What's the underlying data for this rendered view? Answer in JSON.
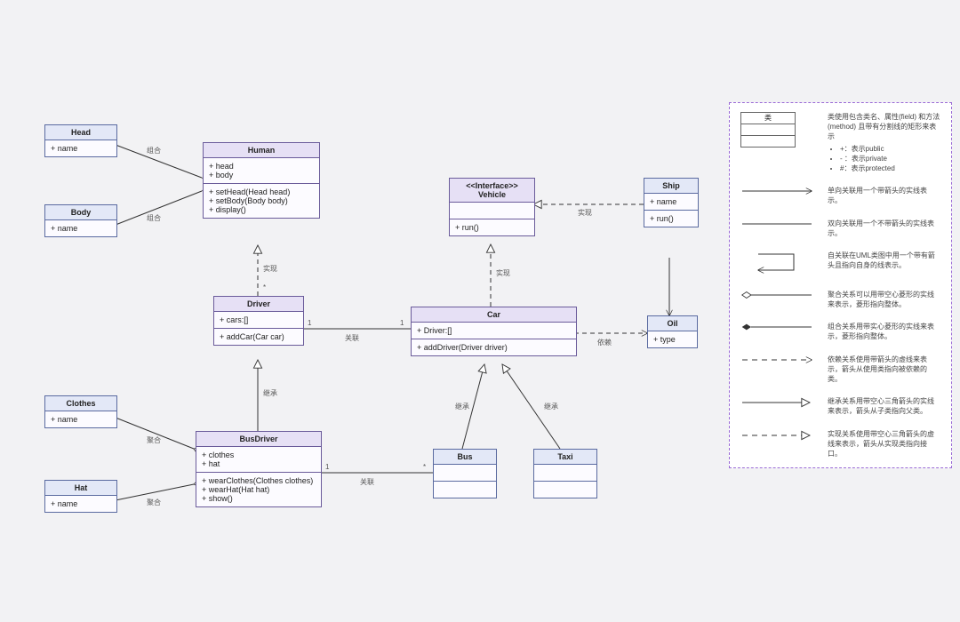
{
  "classes": {
    "Head": {
      "name": "Head",
      "attrs": "+ name",
      "ops": ""
    },
    "Body": {
      "name": "Body",
      "attrs": "+ name",
      "ops": ""
    },
    "Human": {
      "name": "Human",
      "attrs": "+ head\n+ body",
      "ops": "+ setHead(Head head)\n+ setBody(Body body)\n+ display()"
    },
    "Vehicle": {
      "name": "<<Interface>>\nVehicle",
      "attrs": "",
      "ops": "+ run()"
    },
    "Ship": {
      "name": "Ship",
      "attrs": "+ name",
      "ops": "+ run()"
    },
    "Driver": {
      "name": "Driver",
      "attrs": "+ cars:[]",
      "ops": "+ addCar(Car car)"
    },
    "Car": {
      "name": "Car",
      "attrs": "+ Driver:[]",
      "ops": "+ addDriver(Driver driver)"
    },
    "Oil": {
      "name": "Oil",
      "attrs": "+ type",
      "ops": ""
    },
    "Clothes": {
      "name": "Clothes",
      "attrs": "+ name",
      "ops": ""
    },
    "Hat": {
      "name": "Hat",
      "attrs": "+ name",
      "ops": ""
    },
    "BusDriver": {
      "name": "BusDriver",
      "attrs": "+ clothes\n+ hat",
      "ops": "+ wearClothes(Clothes clothes)\n+ wearHat(Hat hat)\n+ show()"
    },
    "Bus": {
      "name": "Bus",
      "attrs": "",
      "ops": ""
    },
    "Taxi": {
      "name": "Taxi",
      "attrs": "",
      "ops": ""
    }
  },
  "edge_labels": {
    "headHuman": "组合",
    "bodyHuman": "组合",
    "humanDriver": "实现",
    "driverBus": "继承",
    "driverCar": "关联",
    "busdriverBus": "关联",
    "clothesBusdriver": "聚合",
    "hatBusdriver": "聚合",
    "carVehicle": "实现",
    "vehicleShip": "实现",
    "carOil": "依赖",
    "carBus": "继承",
    "carTaxi": "继承",
    "one": "1",
    "many": "*"
  },
  "legend": {
    "header": "类",
    "desc_class": "类使用包含类名、属性(field) 和方法(method) 且带有分割线的矩形来表示",
    "vis1": "+：表示public",
    "vis2": "- ：表示private",
    "vis3": "#：表示protected",
    "assoc_uni": "单向关联用一个带箭头的实线表示。",
    "assoc_bi": "双向关联用一个不带箭头的实线表示。",
    "self": "自关联在UML类图中用一个带有箭头且指向自身的线表示。",
    "aggreg": "聚合关系可以用带空心菱形的实线来表示，菱形指向整体。",
    "compose": "组合关系用带实心菱形的实线来表示，菱形指向整体。",
    "depend": "依赖关系使用带箭头的虚线来表示，箭头从使用类指向被依赖的类。",
    "inherit": "继承关系用带空心三角箭头的实线来表示，箭头从子类指向父类。",
    "realize": "实现关系使用带空心三角箭头的虚线来表示，箭头从实现类指向接口。"
  },
  "chart_data": {
    "type": "uml-class-diagram",
    "classes": [
      {
        "name": "Head",
        "attributes": [
          "+ name"
        ],
        "methods": []
      },
      {
        "name": "Body",
        "attributes": [
          "+ name"
        ],
        "methods": []
      },
      {
        "name": "Human",
        "attributes": [
          "+ head",
          "+ body"
        ],
        "methods": [
          "+ setHead(Head head)",
          "+ setBody(Body body)",
          "+ display()"
        ]
      },
      {
        "name": "Vehicle",
        "stereotype": "Interface",
        "attributes": [],
        "methods": [
          "+ run()"
        ]
      },
      {
        "name": "Ship",
        "attributes": [
          "+ name"
        ],
        "methods": [
          "+ run()"
        ]
      },
      {
        "name": "Driver",
        "attributes": [
          "+ cars:[]"
        ],
        "methods": [
          "+ addCar(Car car)"
        ]
      },
      {
        "name": "Car",
        "attributes": [
          "+ Driver:[]"
        ],
        "methods": [
          "+ addDriver(Driver driver)"
        ]
      },
      {
        "name": "Oil",
        "attributes": [
          "+ type"
        ],
        "methods": []
      },
      {
        "name": "Clothes",
        "attributes": [
          "+ name"
        ],
        "methods": []
      },
      {
        "name": "Hat",
        "attributes": [
          "+ name"
        ],
        "methods": []
      },
      {
        "name": "BusDriver",
        "attributes": [
          "+ clothes",
          "+ hat"
        ],
        "methods": [
          "+ wearClothes(Clothes clothes)",
          "+ wearHat(Hat hat)",
          "+ show()"
        ]
      },
      {
        "name": "Bus",
        "attributes": [],
        "methods": []
      },
      {
        "name": "Taxi",
        "attributes": [],
        "methods": []
      }
    ],
    "relationships": [
      {
        "from": "Head",
        "to": "Human",
        "type": "composition",
        "label": "组合"
      },
      {
        "from": "Body",
        "to": "Human",
        "type": "composition",
        "label": "组合"
      },
      {
        "from": "Driver",
        "to": "Human",
        "type": "realization",
        "label": "实现"
      },
      {
        "from": "BusDriver",
        "to": "Driver",
        "type": "inheritance",
        "label": "继承"
      },
      {
        "from": "Driver",
        "to": "Car",
        "type": "association",
        "label": "关联",
        "multiplicity": {
          "from": "1",
          "to": "1"
        }
      },
      {
        "from": "BusDriver",
        "to": "Bus",
        "type": "association",
        "label": "关联",
        "multiplicity": {
          "from": "1",
          "to": "*"
        }
      },
      {
        "from": "Clothes",
        "to": "BusDriver",
        "type": "aggregation",
        "label": "聚合"
      },
      {
        "from": "Hat",
        "to": "BusDriver",
        "type": "aggregation",
        "label": "聚合"
      },
      {
        "from": "Car",
        "to": "Vehicle",
        "type": "realization",
        "label": "实现"
      },
      {
        "from": "Ship",
        "to": "Vehicle",
        "type": "realization",
        "label": "实现"
      },
      {
        "from": "Car",
        "to": "Oil",
        "type": "dependency",
        "label": "依赖"
      },
      {
        "from": "Bus",
        "to": "Car",
        "type": "inheritance",
        "label": "继承"
      },
      {
        "from": "Taxi",
        "to": "Car",
        "type": "inheritance",
        "label": "继承"
      },
      {
        "from": "Ship",
        "to": "Oil",
        "type": "association-uni"
      }
    ]
  }
}
